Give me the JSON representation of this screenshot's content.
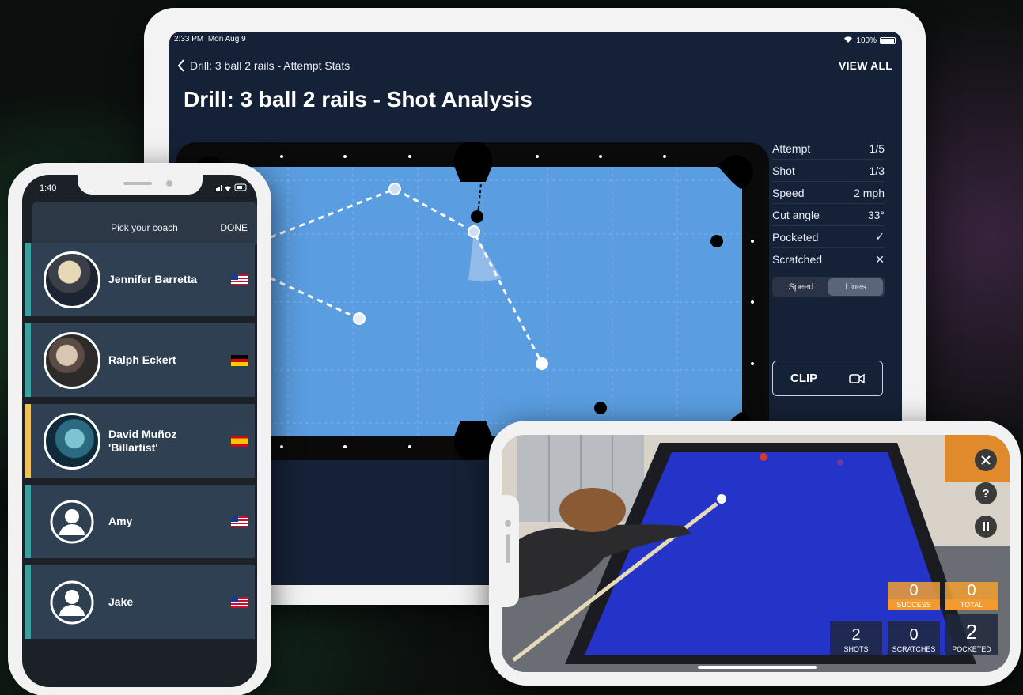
{
  "tablet": {
    "status_time": "2:33 PM",
    "status_date": "Mon Aug 9",
    "battery": "100%",
    "back_label": "Drill: 3 ball 2 rails - Attempt Stats",
    "view_all": "VIEW ALL",
    "title": "Drill: 3 ball 2 rails - Shot Analysis",
    "stats": [
      {
        "label": "Attempt",
        "value": "1/5"
      },
      {
        "label": "Shot",
        "value": "1/3"
      },
      {
        "label": "Speed",
        "value": "2 mph"
      },
      {
        "label": "Cut angle",
        "value": "33°"
      },
      {
        "label": "Pocketed",
        "value": "✓"
      },
      {
        "label": "Scratched",
        "value": "✕"
      }
    ],
    "segment": {
      "option1": "Speed",
      "option2": "Lines",
      "selected": "Lines"
    },
    "clip_label": "CLIP",
    "colors": {
      "background": "#152136",
      "felt": "#5a9de0",
      "rail": "#0a0a0a"
    }
  },
  "coach_picker": {
    "time": "1:40",
    "title": "Pick your coach",
    "done": "DONE",
    "coaches": [
      {
        "name": "Jennifer Barretta",
        "flag": "us-flag-icon",
        "accent": "#3aa0a0"
      },
      {
        "name": "Ralph Eckert",
        "flag": "de-flag-icon",
        "accent": "#3aa0a0"
      },
      {
        "name": "David Muñoz 'Billartist'",
        "flag": "es-flag-icon",
        "accent": "#f0c25a"
      },
      {
        "name": "Amy",
        "flag": "us-flag-icon",
        "accent": "#3aa0a0"
      },
      {
        "name": "Jake",
        "flag": "us-flag-icon",
        "accent": "#3aa0a0"
      }
    ]
  },
  "camera_view": {
    "scores": {
      "success": {
        "value": "0",
        "label": "SUCCESS"
      },
      "total": {
        "value": "0",
        "label": "TOTAL"
      },
      "shots": {
        "value": "2",
        "label": "SHOTS"
      },
      "scratches": {
        "value": "0",
        "label": "SCRATCHES"
      },
      "pocketed": {
        "value": "2",
        "label": "POCKETED"
      }
    },
    "controls": {
      "close": "close-icon",
      "help": "help-icon",
      "pause": "pause-icon"
    },
    "help_glyph": "?",
    "colors": {
      "felt": "#2433c8",
      "orange": "#f29a2e"
    }
  }
}
